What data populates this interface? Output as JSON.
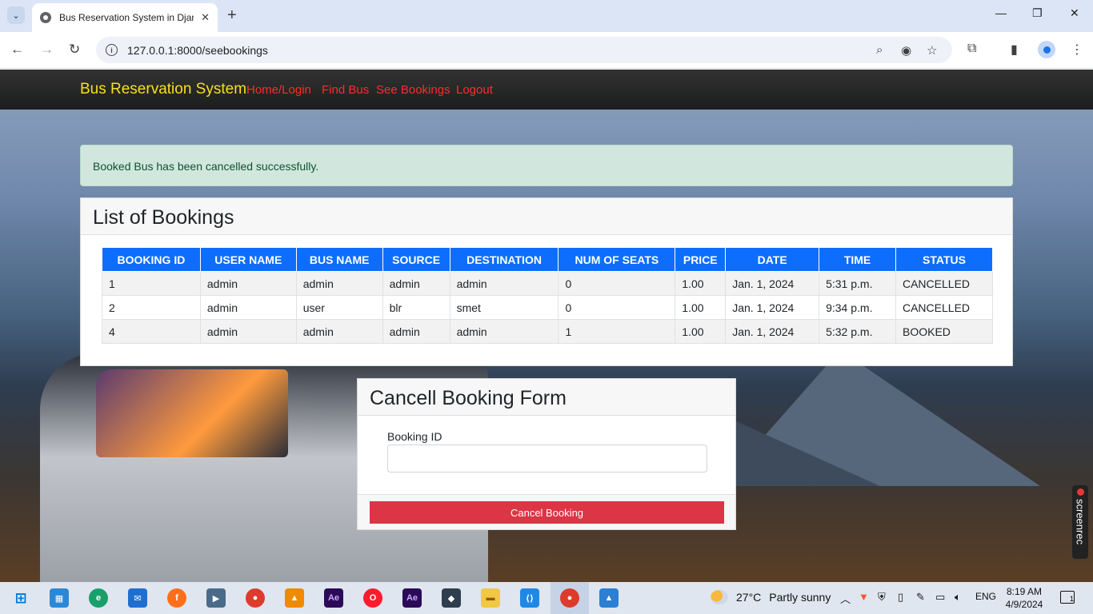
{
  "browser": {
    "tab_title": "Bus Reservation System in Djan",
    "url": "127.0.0.1:8000/seebookings"
  },
  "navbar": {
    "brand": "Bus Reservation System",
    "links": [
      "Home/Login",
      "Find Bus",
      "See Bookings",
      "Logout"
    ]
  },
  "alert": {
    "message": "Booked Bus has been cancelled successfully."
  },
  "bookings": {
    "title": "List of Bookings",
    "columns": [
      "BOOKING ID",
      "USER NAME",
      "BUS NAME",
      "SOURCE",
      "DESTINATION",
      "NUM OF SEATS",
      "PRICE",
      "DATE",
      "TIME",
      "STATUS"
    ],
    "rows": [
      [
        "1",
        "admin",
        "admin",
        "admin",
        "admin",
        "0",
        "1.00",
        "Jan. 1, 2024",
        "5:31 p.m.",
        "CANCELLED"
      ],
      [
        "2",
        "admin",
        "user",
        "blr",
        "smet",
        "0",
        "1.00",
        "Jan. 1, 2024",
        "9:34 p.m.",
        "CANCELLED"
      ],
      [
        "4",
        "admin",
        "admin",
        "admin",
        "admin",
        "1",
        "1.00",
        "Jan. 1, 2024",
        "5:32 p.m.",
        "BOOKED"
      ]
    ]
  },
  "cancel_form": {
    "title": "Cancell Booking Form",
    "label": "Booking ID",
    "value": "",
    "button": "Cancel Booking"
  },
  "overlay": {
    "screenrec": "screenrec"
  },
  "taskbar": {
    "weather_temp": "27°C",
    "weather_desc": "Partly sunny",
    "lang": "ENG",
    "time": "8:19 AM",
    "date": "4/9/2024",
    "notifications": "1"
  },
  "colors": {
    "brand": "#f7e01d",
    "nav_link": "#ff2b2b",
    "table_header": "#0d6efd",
    "cancel_button": "#dc3545",
    "alert_bg": "#d1e7dd"
  }
}
